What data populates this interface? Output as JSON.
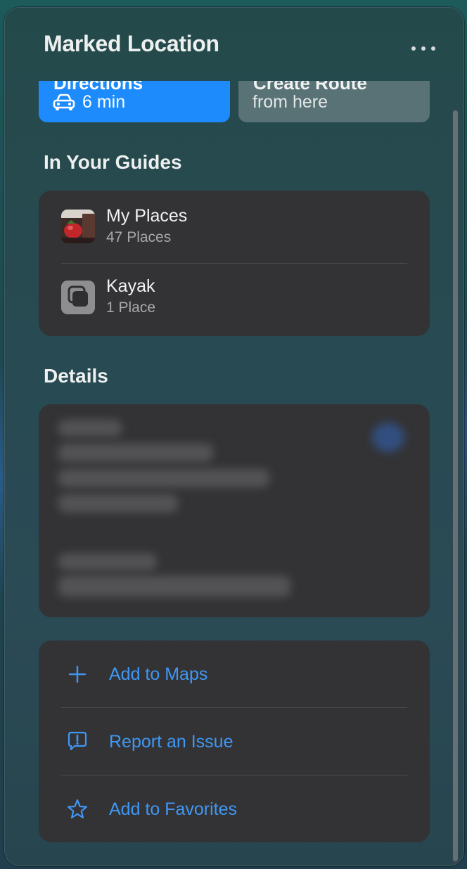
{
  "header": {
    "title": "Marked Location",
    "more_icon": "ellipsis-icon"
  },
  "actions": {
    "directions": {
      "label": "Directions",
      "eta": "6 min",
      "icon": "car-icon"
    },
    "create_route": {
      "label": "Create Route",
      "sub": "from here"
    }
  },
  "guides": {
    "title": "In Your Guides",
    "items": [
      {
        "name": "My Places",
        "count": "47 Places",
        "icon": "photo-thumbnail"
      },
      {
        "name": "Kayak",
        "count": "1 Place",
        "icon": "guide-stack-icon"
      }
    ]
  },
  "details": {
    "title": "Details"
  },
  "more_actions": {
    "items": [
      {
        "label": "Add to Maps",
        "icon": "plus-icon"
      },
      {
        "label": "Report an Issue",
        "icon": "exclamation-bubble-icon"
      },
      {
        "label": "Add to Favorites",
        "icon": "star-icon"
      }
    ]
  },
  "colors": {
    "accent": "#1d8bfb",
    "link": "#3f97f4",
    "card": "#333335"
  }
}
